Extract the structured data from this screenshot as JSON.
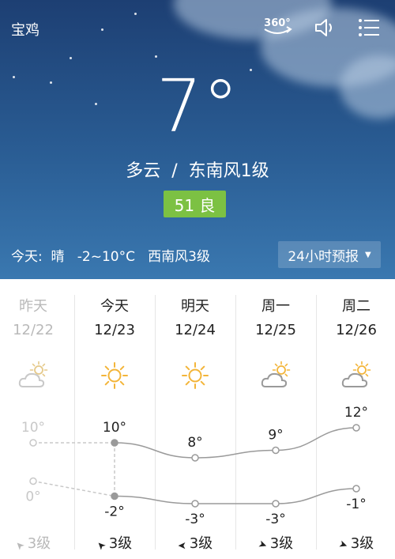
{
  "header": {
    "city": "宝鸡",
    "temperature": "7°",
    "condition": "多云  /  东南风1级",
    "aqi": "51 良"
  },
  "icons": {
    "view360": "360-icon",
    "sound": "speaker-icon",
    "menu": "menu-icon",
    "weather": [
      "partly-cloudy-icon",
      "sunny-icon",
      "sunny-icon",
      "partly-cloudy-icon",
      "partly-cloudy-icon"
    ],
    "wind": [
      "wind-arrow-icon"
    ]
  },
  "today_summary": "今天:  晴   -2~10°C   西南风3级",
  "forecast_button": "24小时预报",
  "days": [
    {
      "day": "昨天",
      "date": "12/22",
      "high": "10°",
      "low": "0°",
      "wind": "3级",
      "high_value": 10,
      "low_value": 0,
      "past": true
    },
    {
      "day": "今天",
      "date": "12/23",
      "high": "10°",
      "low": "-2°",
      "wind": "3级",
      "high_value": 10,
      "low_value": -2,
      "past": false
    },
    {
      "day": "明天",
      "date": "12/24",
      "high": "8°",
      "low": "-3°",
      "wind": "3级",
      "high_value": 8,
      "low_value": -3,
      "past": false
    },
    {
      "day": "周一",
      "date": "12/25",
      "high": "9°",
      "low": "-3°",
      "wind": "3级",
      "high_value": 9,
      "low_value": -3,
      "past": false
    },
    {
      "day": "周二",
      "date": "12/26",
      "high": "12°",
      "low": "-1°",
      "wind": "3级",
      "high_value": 12,
      "low_value": -1,
      "past": false
    }
  ],
  "colors": {
    "sky_top": "#1d3f73",
    "aqi_good": "#7cc143",
    "sun": "#f3b53a",
    "line": "#9a9a9a"
  }
}
